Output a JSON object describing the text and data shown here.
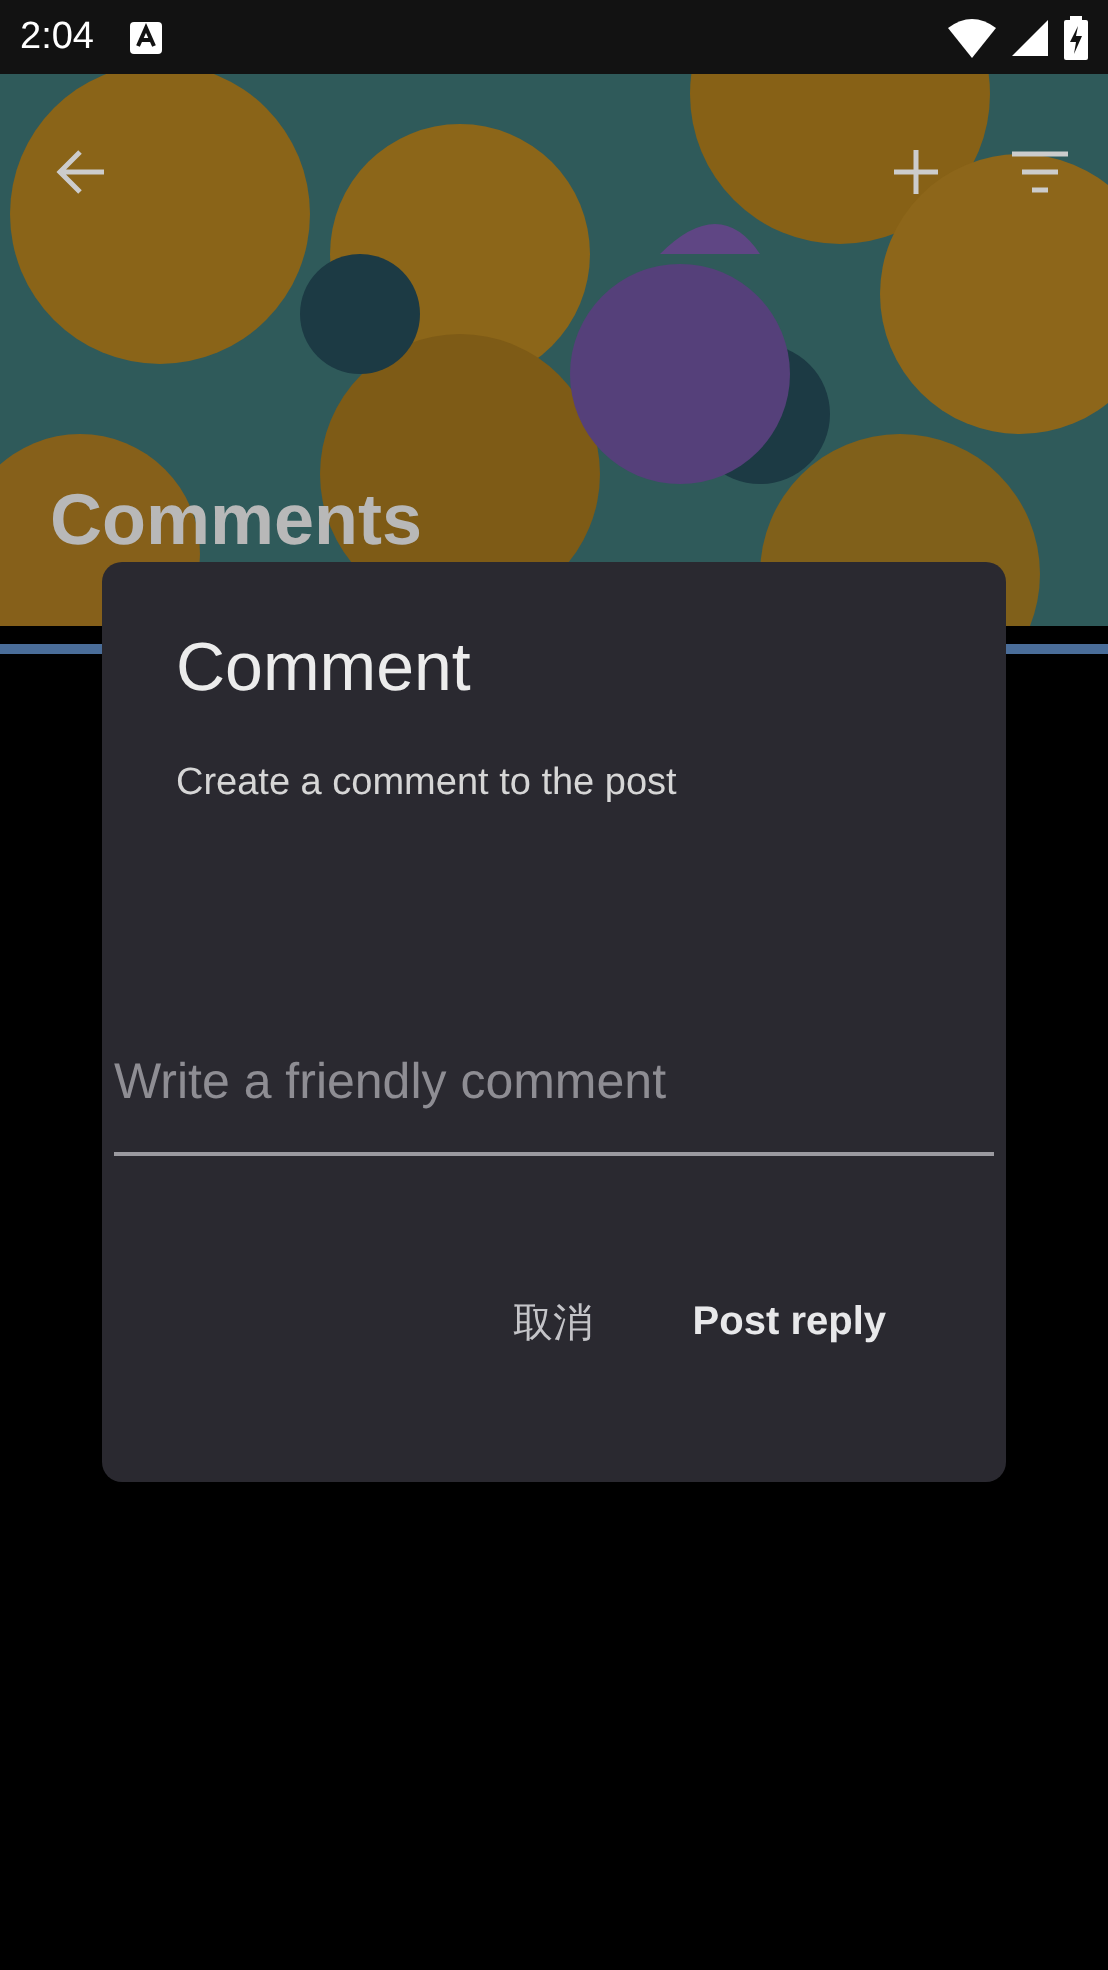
{
  "status_bar": {
    "time": "2:04"
  },
  "header": {
    "title": "Comments"
  },
  "dialog": {
    "title": "Comment",
    "message": "Create a comment to the post",
    "field": {
      "placeholder": "Write a friendly comment"
    },
    "buttons": [
      {
        "label": "取消",
        "kind": "cancel"
      },
      {
        "label": "Post reply",
        "kind": "confirm"
      }
    ]
  }
}
